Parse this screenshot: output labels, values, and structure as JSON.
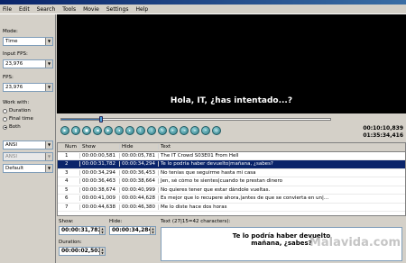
{
  "menu": [
    "File",
    "Edit",
    "Search",
    "Tools",
    "Movie",
    "Settings",
    "Help"
  ],
  "left": {
    "mode_label": "Mode:",
    "mode_value": "Time",
    "input_fps_label": "Input FPS:",
    "input_fps_value": "23,976",
    "fps_label": "FPS:",
    "fps_value": "23,976",
    "work_with_label": "Work with:",
    "radios": [
      "Duration",
      "Final time",
      "Both"
    ],
    "selected_radio": "Both",
    "encoding1": "ANSI",
    "encoding2": "ANSI",
    "format": "Default"
  },
  "video": {
    "subtitle": "Hola, IT, ¿has intentado...?"
  },
  "player": {
    "current_time": "00:10:10,839",
    "total_time": "01:35:34,416",
    "position_fraction": 0.15
  },
  "grid": {
    "headers": [
      "Num",
      "Show",
      "Hide",
      "Text"
    ],
    "rows": [
      [
        "1",
        "00:00:00,581",
        "00:00:05,781",
        "The IT Crowd S03E01 From Hell"
      ],
      [
        "2",
        "00:00:31,782",
        "00:00:34,294",
        "Te lo podría haber devuelto|mañana, ¿sabes?"
      ],
      [
        "3",
        "00:00:34,294",
        "00:00:36,453",
        "No tenías que seguirme hasta mi casa"
      ],
      [
        "4",
        "00:00:36,463",
        "00:00:38,664",
        "Jen, sé cómo te sientes|cuando te prestan dinero"
      ],
      [
        "5",
        "00:00:38,674",
        "00:00:40,999",
        "No quieres tener que estar dándole vueltas."
      ],
      [
        "6",
        "00:00:41,009",
        "00:00:44,628",
        "Es mejor que lo recupere ahora,|antes de que se convierta en un|..."
      ],
      [
        "7",
        "00:00:44,638",
        "00:00:46,380",
        "Me lo diste hace dos horas"
      ]
    ],
    "selected_row": 1
  },
  "editor": {
    "show_label": "Show:",
    "show_value": "00:00:31,782",
    "hide_label": "Hide:",
    "hide_value": "00:00:34,284",
    "duration_label": "Duration:",
    "duration_value": "00:00:02,502",
    "text_label": "Text (27|15=42 characters):",
    "text_line1": "Te lo podría haber devuelto",
    "text_line2": "mañana, ¿sabes?"
  },
  "watermark": "Malavida.com",
  "colors": {
    "selection": "#0a246a",
    "button_accent": "#2f7d88",
    "video_bg": "#000000"
  }
}
